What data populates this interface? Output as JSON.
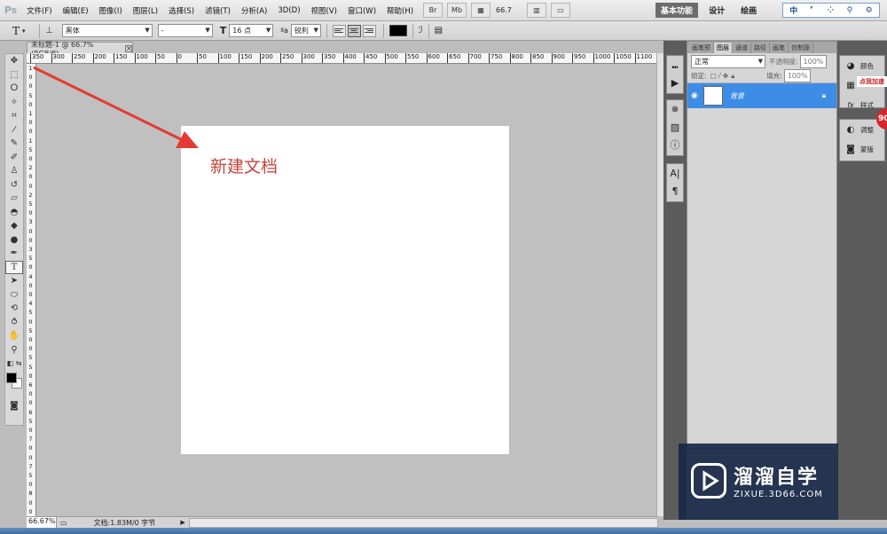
{
  "app": {
    "logo": "Ps",
    "menu": [
      "文件(F)",
      "编辑(E)",
      "图像(I)",
      "图层(L)",
      "选择(S)",
      "滤镜(T)",
      "分析(A)",
      "3D(D)",
      "视图(V)",
      "窗口(W)",
      "帮助(H)"
    ],
    "menubar_buttons": [
      "Br",
      "Mb"
    ],
    "zoom_value": "66.7",
    "workspaces": [
      "基本功能",
      "设计",
      "绘画"
    ],
    "ime": [
      "中",
      "ﾟ",
      "⁘",
      "⚲",
      "⚙"
    ]
  },
  "options": {
    "tool_glyph": "T",
    "font_family": "黑体",
    "font_style": "-",
    "font_size": "16 点",
    "aa_label": "a",
    "aa_mode": "锐利",
    "text_color": "#000000"
  },
  "document": {
    "tab_title": "未标题-1 @ 66.7%(RGB/8)",
    "annotation": "新建文档",
    "status_zoom": "66.67%",
    "status_doc": "文档:1.83M/0 字节"
  },
  "ruler": {
    "top_labels": [
      "350",
      "300",
      "250",
      "200",
      "150",
      "100",
      "50",
      "0",
      "50",
      "100",
      "150",
      "200",
      "250",
      "300",
      "350",
      "400",
      "450",
      "500",
      "550",
      "600",
      "650",
      "700",
      "750",
      "800",
      "850",
      "900",
      "950",
      "1000",
      "1050",
      "1100"
    ],
    "left_labels": [
      "1",
      "0",
      "0",
      "5",
      "0",
      "1",
      "0",
      "0",
      "1",
      "5",
      "0",
      "2",
      "0",
      "0",
      "2",
      "5",
      "0",
      "3",
      "0",
      "0",
      "3",
      "5",
      "0",
      "4",
      "0",
      "0",
      "4",
      "5",
      "0",
      "5",
      "0",
      "0",
      "5",
      "5",
      "0",
      "6",
      "0",
      "0",
      "6",
      "5",
      "0",
      "7",
      "0",
      "0",
      "7",
      "5",
      "0",
      "8",
      "0",
      "0"
    ]
  },
  "layers": {
    "tabs": [
      "画笔预",
      "图层",
      "通道",
      "路径",
      "画笔",
      "仿制源"
    ],
    "blend_mode": "正常",
    "opacity_label": "不透明度:",
    "opacity_value": "100%",
    "lock_label": "锁定:",
    "fill_label": "填充:",
    "fill_value": "100%",
    "layer_name": "背景"
  },
  "mini_panels": {
    "items": [
      "颜色",
      "样式",
      "调整",
      "蒙版"
    ],
    "tag": "点我加速",
    "badge": "90"
  },
  "watermark": {
    "title": "溜溜自学",
    "url": "ZIXUE.3D66.COM"
  }
}
